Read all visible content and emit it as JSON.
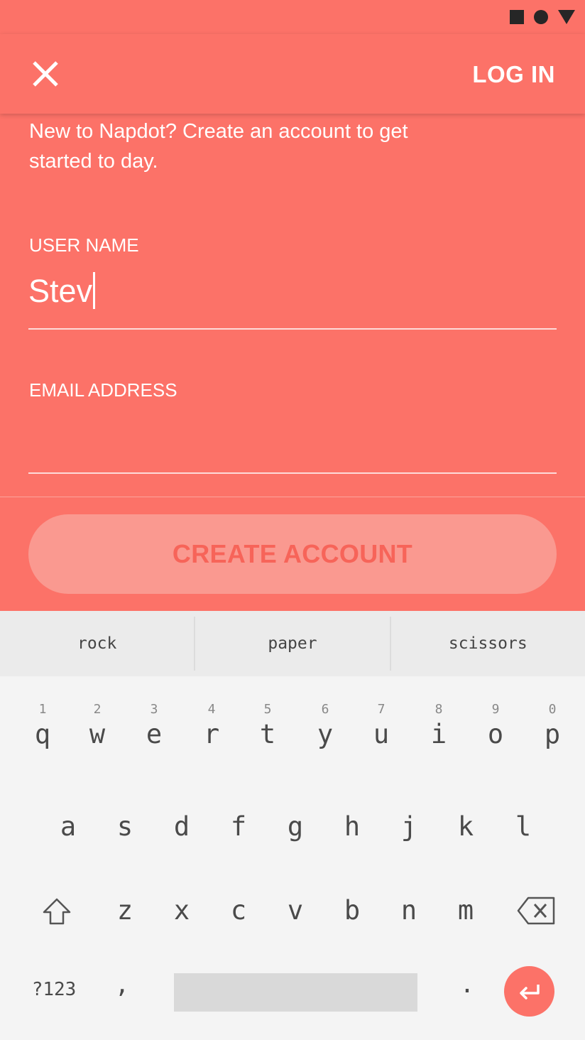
{
  "appbar": {
    "login_label": "LOG IN"
  },
  "intro": "New to Napdot? Create an account to get started to day.",
  "form": {
    "username_label": "USER NAME",
    "username_value": "Stev",
    "email_label": "EMAIL ADDRESS",
    "email_value": ""
  },
  "create_button_label": "CREATE ACCOUNT",
  "suggestions": [
    "rock",
    "paper",
    "scissors"
  ],
  "keyboard": {
    "row1_numbers": [
      "1",
      "2",
      "3",
      "4",
      "5",
      "6",
      "7",
      "8",
      "9",
      "0"
    ],
    "row1": [
      "q",
      "w",
      "e",
      "r",
      "t",
      "y",
      "u",
      "i",
      "o",
      "p"
    ],
    "row2": [
      "a",
      "s",
      "d",
      "f",
      "g",
      "h",
      "j",
      "k",
      "l"
    ],
    "row3": [
      "z",
      "x",
      "c",
      "v",
      "b",
      "n",
      "m"
    ],
    "symbols_label": "?123",
    "comma": ",",
    "period": "."
  },
  "colors": {
    "primary": "#FC7268",
    "button": "#FA9990",
    "button_text": "#F76459"
  }
}
